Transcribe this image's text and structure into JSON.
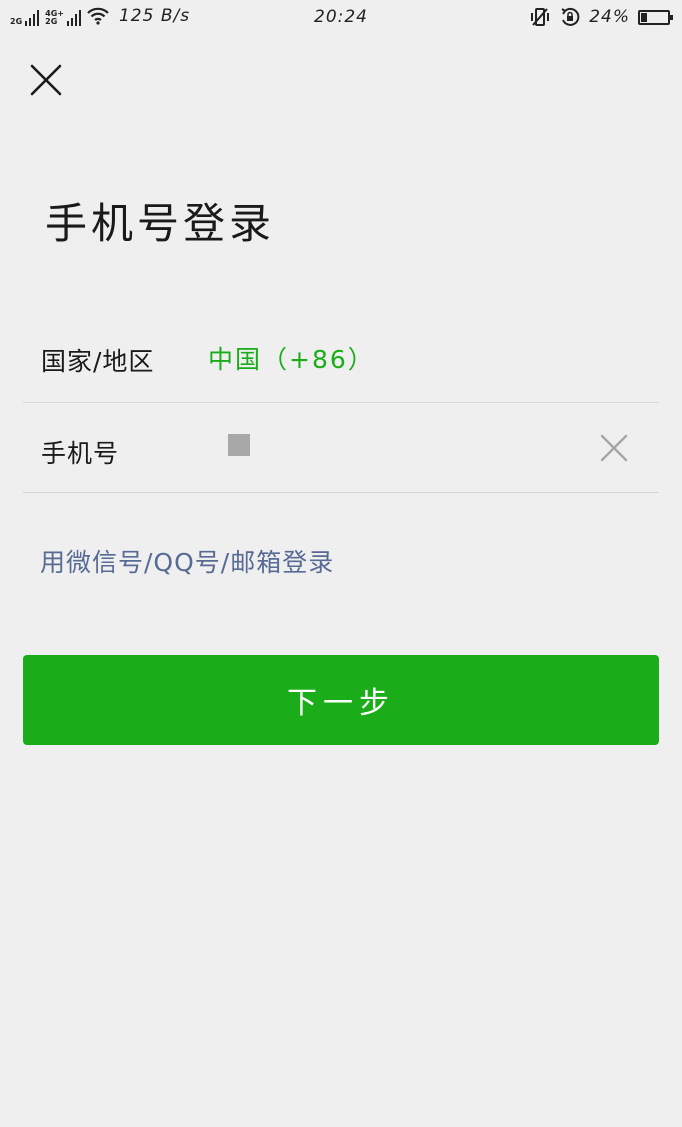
{
  "status_bar": {
    "network_1": "2G",
    "network_2_top": "4G+",
    "network_2_bottom": "2G",
    "net_speed": "125 B/s",
    "time": "20:24",
    "battery_percent": "24%",
    "battery_level": 0.24,
    "icons": [
      "signal-icon",
      "wifi-icon",
      "vibrate-icon",
      "rotation-lock-icon",
      "battery-icon"
    ]
  },
  "header": {
    "close_icon": "close-icon",
    "title": "手机号登录"
  },
  "form": {
    "region_label": "国家/地区",
    "region_value": "中国（+86）",
    "phone_label": "手机号",
    "phone_value": "",
    "clear_icon": "clear-icon"
  },
  "alt_login_link": "用微信号/QQ号/邮箱登录",
  "next_button": "下一步",
  "colors": {
    "background": "#efefef",
    "accent_green": "#1aad19",
    "link_blue": "#576b95",
    "divider": "#d6d6d6"
  }
}
